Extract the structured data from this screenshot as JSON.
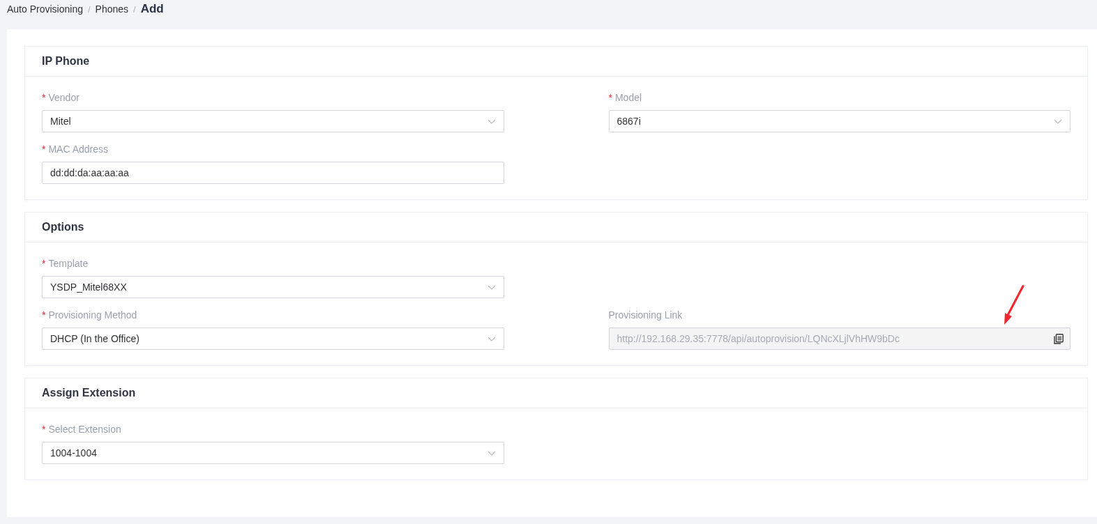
{
  "breadcrumb": [
    {
      "label": "Auto Provisioning",
      "current": false
    },
    {
      "label": "Phones",
      "current": false
    },
    {
      "label": "Add",
      "current": true
    }
  ],
  "breadcrumb_separator": "/",
  "sections": [
    {
      "title": "IP Phone",
      "rows": [
        {
          "left": {
            "kind": "select",
            "label": "Vendor",
            "required": true,
            "value": "Mitel"
          },
          "right": {
            "kind": "select",
            "label": "Model",
            "required": true,
            "value": "6867i"
          }
        },
        {
          "left": {
            "kind": "input",
            "label": "MAC Address",
            "required": true,
            "value": "dd:dd:da:aa:aa:aa"
          }
        }
      ]
    },
    {
      "title": "Options",
      "rows": [
        {
          "left": {
            "kind": "select",
            "label": "Template",
            "required": true,
            "value": "YSDP_Mitel68XX"
          }
        },
        {
          "left": {
            "kind": "select",
            "label": "Provisioning Method",
            "required": true,
            "value": "DHCP (In the Office)"
          },
          "right": {
            "kind": "readonly",
            "label": "Provisioning Link",
            "required": false,
            "value": "http://192.168.29.35:7778/api/autoprovision/LQNcXLjlVhHW9bDc"
          }
        }
      ]
    },
    {
      "title": "Assign Extension",
      "rows": [
        {
          "left": {
            "kind": "select",
            "label": "Select Extension",
            "required": true,
            "value": "1004-1004"
          }
        }
      ]
    }
  ],
  "required_mark": "*"
}
